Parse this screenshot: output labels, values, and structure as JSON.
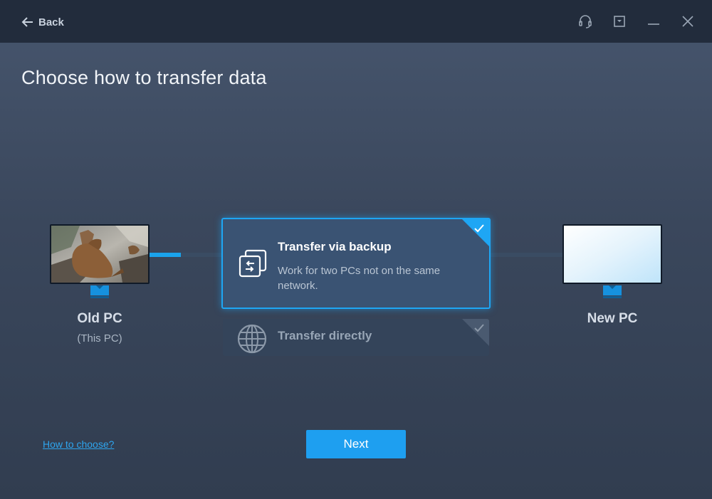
{
  "header": {
    "back_label": "Back",
    "icons": [
      "headset-icon",
      "download-icon",
      "minimize-icon",
      "close-icon"
    ]
  },
  "page": {
    "title": "Choose how to transfer data"
  },
  "old_pc": {
    "label": "Old PC",
    "sublabel": "(This PC)"
  },
  "new_pc": {
    "label": "New PC"
  },
  "options": [
    {
      "title": "Transfer via backup",
      "description": "Work for two PCs not on the same network.",
      "selected": true,
      "icon": "backup-transfer-icon"
    },
    {
      "title": "Transfer directly",
      "selected": false,
      "icon": "globe-icon"
    }
  ],
  "footer": {
    "help_link": "How to choose?",
    "next_label": "Next"
  },
  "colors": {
    "accent": "#1e9ff0",
    "titlebar": "#222c3c",
    "selected_border": "#1ea6f4"
  }
}
